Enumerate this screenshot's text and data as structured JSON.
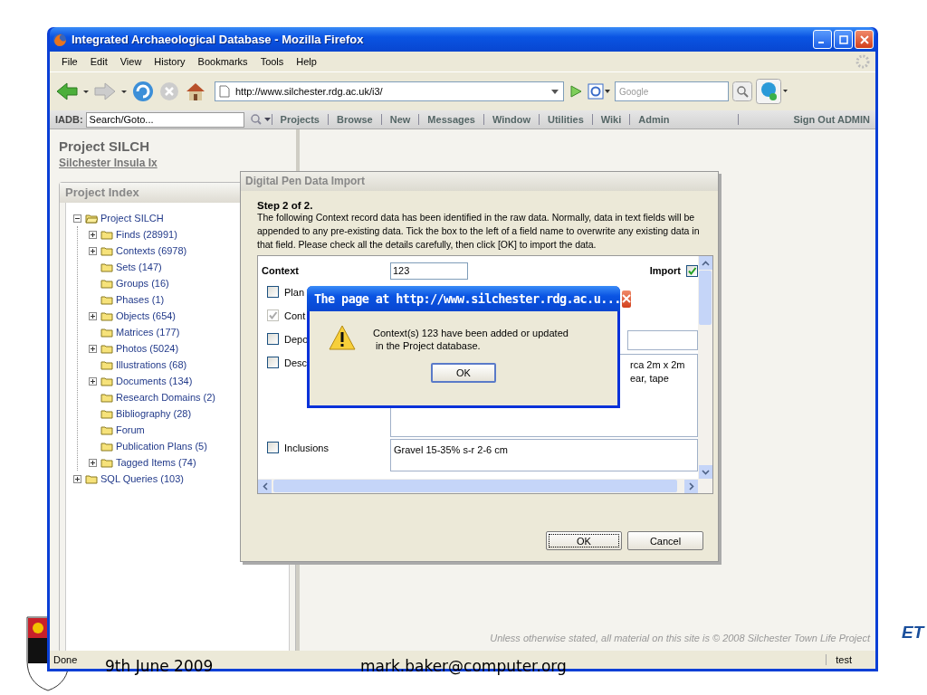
{
  "window": {
    "title": "Integrated Archaeological Database - Mozilla Firefox"
  },
  "menu": [
    "File",
    "Edit",
    "View",
    "History",
    "Bookmarks",
    "Tools",
    "Help"
  ],
  "address_bar": {
    "url": "http://www.silchester.rdg.ac.uk/i3/"
  },
  "search_bar": {
    "placeholder": "Google"
  },
  "site_bar": {
    "label": "IADB:",
    "search_value": "Search/Goto...",
    "items": [
      "Projects",
      "Browse",
      "New",
      "Messages",
      "Window",
      "Utilities",
      "Wiki",
      "Admin"
    ],
    "sign_out": "Sign Out ADMIN"
  },
  "project": {
    "title": "Project SILCH",
    "subtitle": "Silchester Insula Ix"
  },
  "project_index": {
    "title": "Project Index",
    "tree": [
      {
        "label": "Project SILCH",
        "kind": "branch",
        "expanded": true,
        "children": [
          {
            "label": "Finds (28991)",
            "kind": "branch",
            "expanded": false
          },
          {
            "label": "Contexts (6978)",
            "kind": "branch",
            "expanded": false
          },
          {
            "label": "Sets (147)",
            "kind": "leaf"
          },
          {
            "label": "Groups (16)",
            "kind": "leaf"
          },
          {
            "label": "Phases (1)",
            "kind": "leaf"
          },
          {
            "label": "Objects (654)",
            "kind": "branch",
            "expanded": false
          },
          {
            "label": "Matrices (177)",
            "kind": "leaf"
          },
          {
            "label": "Photos (5024)",
            "kind": "branch",
            "expanded": false
          },
          {
            "label": "Illustrations (68)",
            "kind": "leaf"
          },
          {
            "label": "Documents (134)",
            "kind": "branch",
            "expanded": false
          },
          {
            "label": "Research Domains (2)",
            "kind": "leaf"
          },
          {
            "label": "Bibliography (28)",
            "kind": "leaf"
          },
          {
            "label": "Forum",
            "kind": "leaf"
          },
          {
            "label": "Publication Plans (5)",
            "kind": "leaf"
          },
          {
            "label": "Tagged Items (74)",
            "kind": "branch",
            "expanded": false
          }
        ]
      },
      {
        "label": "SQL Queries (103)",
        "kind": "branch",
        "expanded": false
      }
    ]
  },
  "import_dialog": {
    "title": "Digital Pen Data Import",
    "step": "Step 2 of 2.",
    "instructions": "The following Context record data has been identified in the raw data. Normally, data in text fields will be appended to any pre-existing data. Tick the box to the left of a field name to overwrite any existing data in that field. Please check all the details carefully, then click [OK] to import the data.",
    "context_label": "Context",
    "context_value": "123",
    "import_label": "Import",
    "import_checked": true,
    "fields": [
      {
        "label": "Plan",
        "checked": false,
        "disabled": false,
        "kind": "none"
      },
      {
        "label": "Cont",
        "checked": true,
        "disabled": true,
        "kind": "none"
      },
      {
        "label": "Depo",
        "checked": false,
        "disabled": false,
        "kind": "input"
      },
      {
        "label": "Desc",
        "checked": false,
        "disabled": false,
        "kind": "textarea",
        "lines": [
          "rca 2m x 2m",
          "ear, tape"
        ]
      },
      {
        "label": "Inclusions",
        "checked": false,
        "disabled": false,
        "kind": "textarea",
        "lines": [
          "Gravel 15-35% s-r 2-6 cm"
        ]
      }
    ],
    "buttons": [
      "OK",
      "Cancel"
    ]
  },
  "alert": {
    "title": "The page at http://www.silchester.rdg.ac.u...",
    "message_lines": [
      "Context(s) 123 have been added or updated",
      " in the Project database."
    ],
    "button": "OK"
  },
  "copyright": "Unless otherwise stated, all material on this site is © 2008 Silchester Town Life Project",
  "status_bar": {
    "status": "Done",
    "right": "test"
  },
  "slide": {
    "date": "9th June 2009",
    "email": "mark.baker@computer.org",
    "logo_text": "ET"
  }
}
